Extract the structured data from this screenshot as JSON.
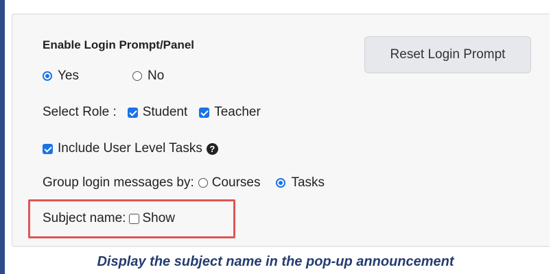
{
  "panel": {
    "heading": "Enable Login Prompt/Panel",
    "reset_button": "Reset Login Prompt",
    "enable_options": {
      "yes_label": "Yes",
      "yes_checked": true,
      "no_label": "No",
      "no_checked": false
    },
    "role": {
      "label": "Select Role :",
      "student_label": "Student",
      "student_checked": true,
      "teacher_label": "Teacher",
      "teacher_checked": true
    },
    "user_level_tasks": {
      "label": "Include User Level Tasks",
      "checked": true,
      "help_icon": "question-circle-icon"
    },
    "group_by": {
      "label": "Group login messages by:",
      "courses_label": "Courses",
      "courses_checked": false,
      "tasks_label": "Tasks",
      "tasks_checked": true
    },
    "subject_name": {
      "label": "Subject name:",
      "show_label": "Show",
      "show_checked": false
    }
  },
  "caption": "Display the subject name in the pop-up announcement",
  "colors": {
    "outer_background": "#2d4a8a",
    "accent": "#1a73e8",
    "highlight_border": "#e05555",
    "caption_text": "#253c6e"
  }
}
